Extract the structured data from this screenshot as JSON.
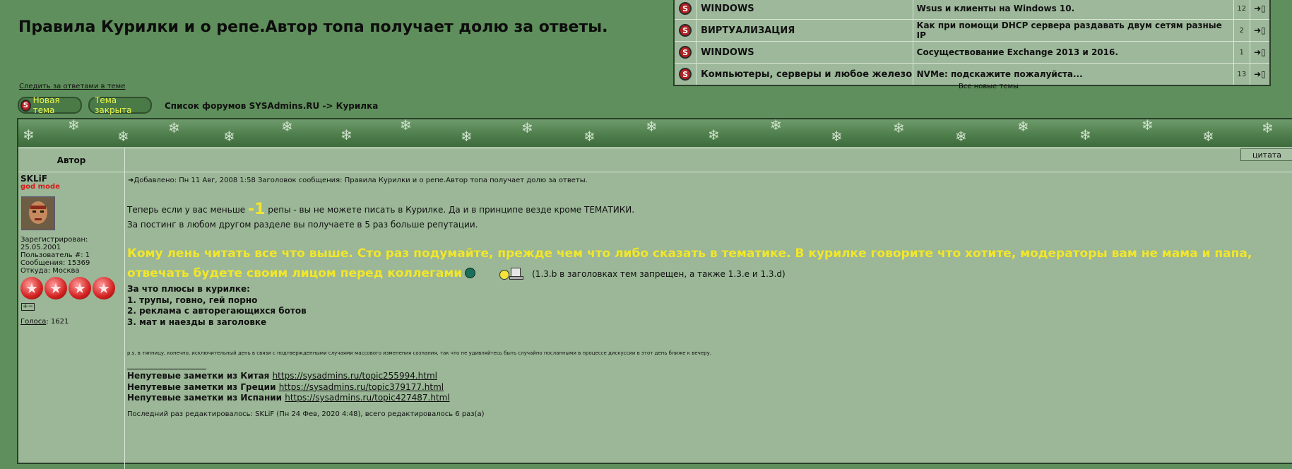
{
  "topic": {
    "title": "Правила Курилки и о репе.Автор топа получает долю за ответы.",
    "watch_link": "Следить за ответами в теме",
    "breadcrumb": "Список форумов SYSAdmins.RU -> Курилка",
    "new_topic_label": "Новая тема",
    "locked_label": "Тема закрыта"
  },
  "recent": {
    "rows": [
      {
        "forum": "WINDOWS",
        "topic": "Wsus и клиенты на Windows 10.",
        "count": "12"
      },
      {
        "forum": "ВИРТУАЛИЗАЦИЯ",
        "topic": "Как при помощи DHCP сервера раздавать двум сетям разные IP",
        "count": "2"
      },
      {
        "forum": "WINDOWS",
        "topic": "Сосуществование Exchange 2013 и 2016.",
        "count": "1"
      },
      {
        "forum": "Компьютеры, серверы и любое железо",
        "topic": "NVMe: подскажите пожалуйста...",
        "count": "13"
      }
    ],
    "all_new": "Все новые темы"
  },
  "table": {
    "author_header": "Автор"
  },
  "author": {
    "name": "SKLiF",
    "rank": "god mode",
    "registered_label": "Зарегистрирован:",
    "registered": "25.05.2001",
    "user_no": "Пользователь #: 1",
    "posts": "Сообщения: 15369",
    "from": "Откуда: Москва",
    "votes_label": "Голоса",
    "votes": ": 1621"
  },
  "post": {
    "meta": "Добавлено: Пн 11 Авг, 2008 1:58    Заголовок сообщения: Правила Курилки и о репе.Автор топа получает долю за ответы.",
    "quote_label": "цитата",
    "report_label": "[!]",
    "line1_before": "Теперь если у вас меньше ",
    "line1_big": "-1",
    "line1_after": " репы - вы не можете писать в Курилке. Да и в принципе везде кроме ТЕМАТИКИ.",
    "line2": "За постинг в любом другом разделе вы получаете в 5 раз больше репутации.",
    "highlight": "Кому лень читать все что выше. Сто раз подумайте, прежде чем что либо сказать в тематике. В курилке говорите что хотите, модераторы вам не мама и папа, отвечать будете своим лицом перед коллегами",
    "highlight_note": "(1.3.b в заголовках тем запрещен, а также 1.3.e и 1.3.d)",
    "list_title": "За что плюсы в курилке:",
    "list_items": [
      "1. трупы, говно, гей порно",
      "2. реклама с авторегающихся ботов",
      "3. мат и наезды в заголовке"
    ],
    "ps": "p.s. в тяпницу, конечно, исключительный день в связи с подтвержденными случаями массового изменения сознания, так что не удивляйтесь быть случайно посланными в процессе дискуссии в этот день ближе к вечеру.",
    "sig": [
      {
        "label": "Непутевые заметки из Китая ",
        "url": "https://sysadmins.ru/topic255994.html"
      },
      {
        "label": "Непутевые заметки из Греции ",
        "url": "https://sysadmins.ru/topic379177.html"
      },
      {
        "label": "Непутевые заметки из Испании ",
        "url": "https://sysadmins.ru/topic427487.html"
      }
    ],
    "edited": "Последний раз редактировалось: SKLiF (Пн 24 Фев, 2020 4:48), всего редактировалось 6 раз(а)"
  },
  "icons": {
    "s_badge": "S",
    "go_arrow": "➜▯",
    "meta_arrow": "➜",
    "star": "★",
    "mini": "+−"
  },
  "colors": {
    "page_bg": "#5f8f5c",
    "highlight": "#f2e62a",
    "rank": "#d41c1c"
  }
}
